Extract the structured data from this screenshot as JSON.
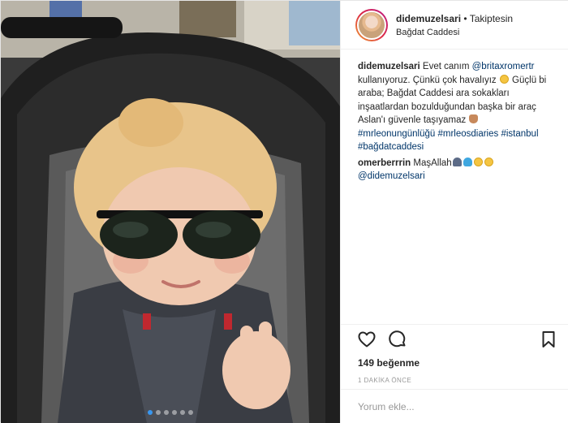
{
  "header": {
    "username": "didemuzelsari",
    "separator": " • ",
    "follow_status": "Takiptesin",
    "location": "Bağdat Caddesi"
  },
  "caption": {
    "username": "didemuzelsari",
    "text_1": " Evet canım ",
    "mention": "@britaxromertr",
    "text_2": " kullanıyoruz. Çünkü çok havalıyız ",
    "text_3": " Güçlü bi araba; Bağdat Caddesi ara sokakları inşaatlardan bozulduğundan başka bir araç Aslan'ı güvenle taşıyamaz ",
    "hashtags": [
      "#mrleonungünlüğü",
      "#mrleosdiaries",
      "#istanbul",
      "#bağdatcaddesi"
    ]
  },
  "comment": {
    "username": "omerberrrin",
    "text": " MaşAllah",
    "mention": "@didemuzelsari"
  },
  "likes": "149 beğenme",
  "time": "1 DAKİKA ÖNCE",
  "add_comment": {
    "placeholder": "Yorum ekle..."
  },
  "carousel": {
    "count": 6,
    "active_index": 0
  },
  "colors": {
    "link": "#003569",
    "active_dot": "#3897f0",
    "border": "#efefef"
  },
  "icons": {
    "like": "heart-outline-icon",
    "comment": "speech-bubble-icon",
    "save": "bookmark-icon"
  }
}
